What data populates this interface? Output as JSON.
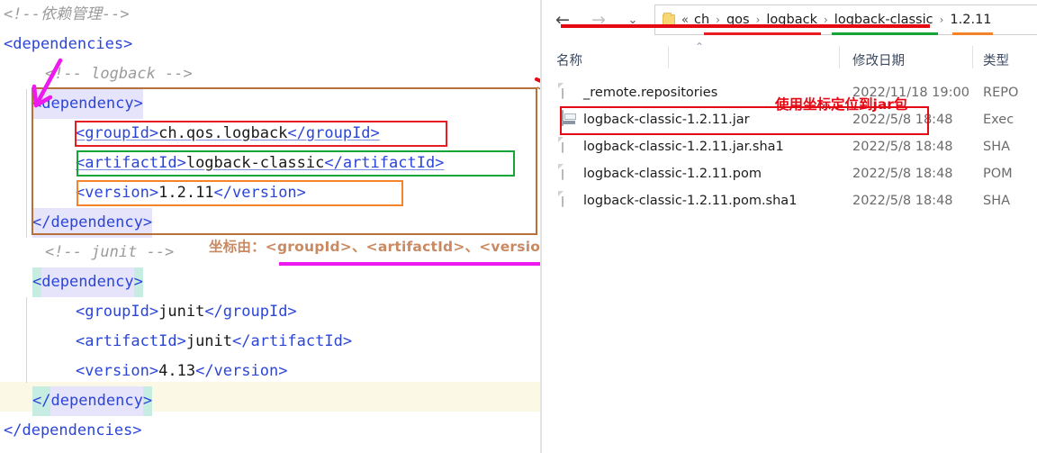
{
  "editor": {
    "lines": [
      {
        "indent": 0,
        "type": "comment",
        "text": "<!--依赖管理-->"
      },
      {
        "indent": 0,
        "type": "tag",
        "text": "<dependencies>"
      },
      {
        "indent": 1,
        "type": "comment",
        "text": "<!-- logback -->"
      },
      {
        "indent": 1,
        "type": "tag",
        "text": "<dependency>"
      },
      {
        "indent": 2,
        "type": "element",
        "open": "<groupId>",
        "value": "ch.qos.logback",
        "close": "</groupId>"
      },
      {
        "indent": 2,
        "type": "element",
        "open": "<artifactId>",
        "value": "logback-classic",
        "close": "</artifactId>"
      },
      {
        "indent": 2,
        "type": "element",
        "open": "<version>",
        "value": "1.2.11",
        "close": "</version>"
      },
      {
        "indent": 1,
        "type": "tag",
        "text": "</dependency>"
      },
      {
        "indent": 1,
        "type": "comment",
        "text": "<!-- junit -->"
      },
      {
        "indent": 1,
        "type": "tag",
        "text": "<dependency>"
      },
      {
        "indent": 2,
        "type": "element",
        "open": "<groupId>",
        "value": "junit",
        "close": "</groupId>"
      },
      {
        "indent": 2,
        "type": "element",
        "open": "<artifactId>",
        "value": "junit",
        "close": "</artifactId>"
      },
      {
        "indent": 2,
        "type": "element",
        "open": "<version>",
        "value": "4.13",
        "close": "</version>"
      },
      {
        "indent": 1,
        "type": "tag",
        "text": "</dependency>"
      },
      {
        "indent": 0,
        "type": "tag",
        "text": "</dependencies>"
      }
    ]
  },
  "annotations": {
    "coordinate_note": "坐标由：<groupId>、<artifactId>、<version>三个标签组成",
    "jar_note": "使用坐标定位到jar包",
    "colors": {
      "brown": "#b5703c",
      "red": "#ea1c23",
      "green": "#13a538",
      "orange": "#f5832a",
      "magenta": "#ee19ee",
      "note_red": "#e50914",
      "note_brown": "#c98a62"
    }
  },
  "explorer": {
    "nav": {
      "back": "←",
      "forward": "→",
      "recent": "⌄",
      "up": "↑"
    },
    "address": {
      "folder_icon": "folder-icon",
      "overflow": "«",
      "separator": "›",
      "crumbs": [
        "ch",
        "qos",
        "logback",
        "logback-classic",
        "1.2.11"
      ]
    },
    "columns": [
      {
        "label": "名称",
        "sort": "ascending"
      },
      {
        "label": "修改日期"
      },
      {
        "label": "类型"
      }
    ],
    "files": [
      {
        "name": "_remote.repositories",
        "date": "2022/11/18 19:00",
        "type": "REPO",
        "icon": "document-icon",
        "selected": false
      },
      {
        "name": "logback-classic-1.2.11.jar",
        "date": "2022/5/8 18:48",
        "type": "Exec",
        "icon": "executable-icon",
        "selected": true
      },
      {
        "name": "logback-classic-1.2.11.jar.sha1",
        "date": "2022/5/8 18:48",
        "type": "SHA",
        "icon": "document-icon",
        "selected": false
      },
      {
        "name": "logback-classic-1.2.11.pom",
        "date": "2022/5/8 18:48",
        "type": "POM",
        "icon": "document-icon",
        "selected": false
      },
      {
        "name": "logback-classic-1.2.11.pom.sha1",
        "date": "2022/5/8 18:48",
        "type": "SHA",
        "icon": "document-icon",
        "selected": false
      }
    ]
  }
}
